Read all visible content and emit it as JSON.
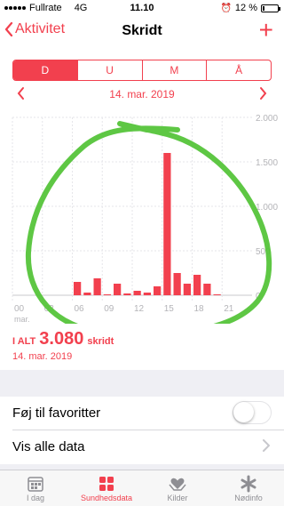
{
  "status_bar": {
    "carrier": "Fullrate",
    "network": "4G",
    "time": "11.10",
    "battery_percent": "12 %",
    "battery_level": 0.12
  },
  "nav": {
    "back_label": "Aktivitet",
    "title": "Skridt",
    "add_icon": "plus-icon",
    "accent_color": "#f2404e"
  },
  "segments": {
    "items": [
      {
        "label": "D",
        "active": true
      },
      {
        "label": "U",
        "active": false
      },
      {
        "label": "M",
        "active": false
      },
      {
        "label": "Å",
        "active": false
      }
    ]
  },
  "date_nav": {
    "date": "14. mar. 2019"
  },
  "chart_data": {
    "type": "bar",
    "x_hours": [
      6,
      7,
      8,
      9,
      10,
      11,
      12,
      13,
      14,
      15,
      16,
      17,
      18,
      19,
      20
    ],
    "values": [
      150,
      30,
      190,
      10,
      130,
      20,
      50,
      30,
      100,
      1600,
      250,
      130,
      230,
      130,
      10
    ],
    "x_ticks": [
      "00",
      "03",
      "06",
      "09",
      "12",
      "15",
      "18",
      "21"
    ],
    "x_tick_hours": [
      0,
      3,
      6,
      9,
      12,
      15,
      18,
      21
    ],
    "x_sublabel": "mar.",
    "y_ticks": [
      "0",
      "500",
      "1.000",
      "1.500",
      "2.000"
    ],
    "y_tick_values": [
      0,
      500,
      1000,
      1500,
      2000
    ],
    "ylim": [
      0,
      2000
    ],
    "bar_color": "#f2404e",
    "grid": true
  },
  "summary": {
    "prefix": "I ALT",
    "value": "3.080",
    "unit": "skridt",
    "date": "14. mar. 2019"
  },
  "rows": {
    "favorite_label": "Føj til favoritter",
    "favorite_on": false,
    "all_data_label": "Vis alle data"
  },
  "tabs": [
    {
      "label": "I dag",
      "icon": "calendar-icon",
      "active": false
    },
    {
      "label": "Sundhedsdata",
      "icon": "grid-icon",
      "active": true
    },
    {
      "label": "Kilder",
      "icon": "heart-hands-icon",
      "active": false
    },
    {
      "label": "Nødinfo",
      "icon": "asterisk-icon",
      "active": false
    }
  ]
}
